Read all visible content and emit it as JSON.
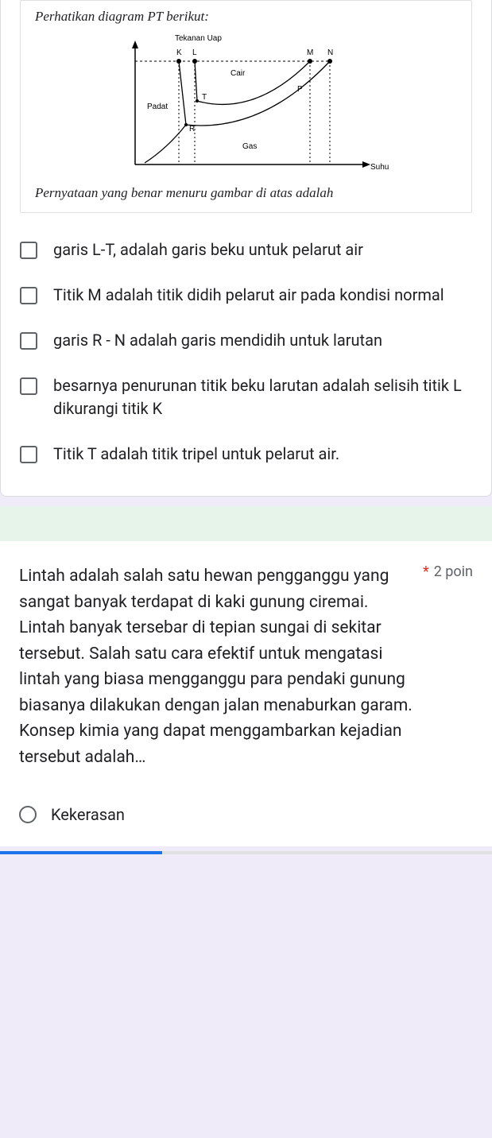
{
  "question1": {
    "diagram": {
      "caption_top": "Perhatikan diagram PT berikut:",
      "y_axis": "Tekanan Uap",
      "x_axis": "Suhu",
      "labels": {
        "K": "K",
        "L": "L",
        "M": "M",
        "N": "N",
        "Cair": "Cair",
        "Gas": "Gas",
        "Padat": "Padat",
        "T": "T",
        "R": "R",
        "P": "P"
      },
      "caption_bottom": "Pernyataan yang benar menuru gambar di atas adalah"
    },
    "options": [
      "garis L-T, adalah garis beku untuk pelarut air",
      "Titik M adalah titik didih pelarut air pada kondisi normal",
      "garis R - N adalah garis mendidih untuk larutan",
      "besarnya penurunan titik beku larutan adalah selisih titik L dikurangi titik K",
      "Titik T adalah titik tripel untuk pelarut air."
    ]
  },
  "question2": {
    "text": "Lintah adalah salah satu hewan pengganggu yang sangat banyak terdapat di kaki gunung ciremai. Lintah banyak tersebar di tepian sungai di sekitar tersebut. Salah satu cara efektif untuk mengatasi lintah yang biasa mengganggu para pendaki gunung biasanya dilakukan dengan jalan menaburkan garam. Konsep kimia yang dapat menggambarkan kejadian tersebut adalah…",
    "required_marker": "*",
    "points": "2 poin",
    "options": [
      "Kekerasan"
    ]
  }
}
